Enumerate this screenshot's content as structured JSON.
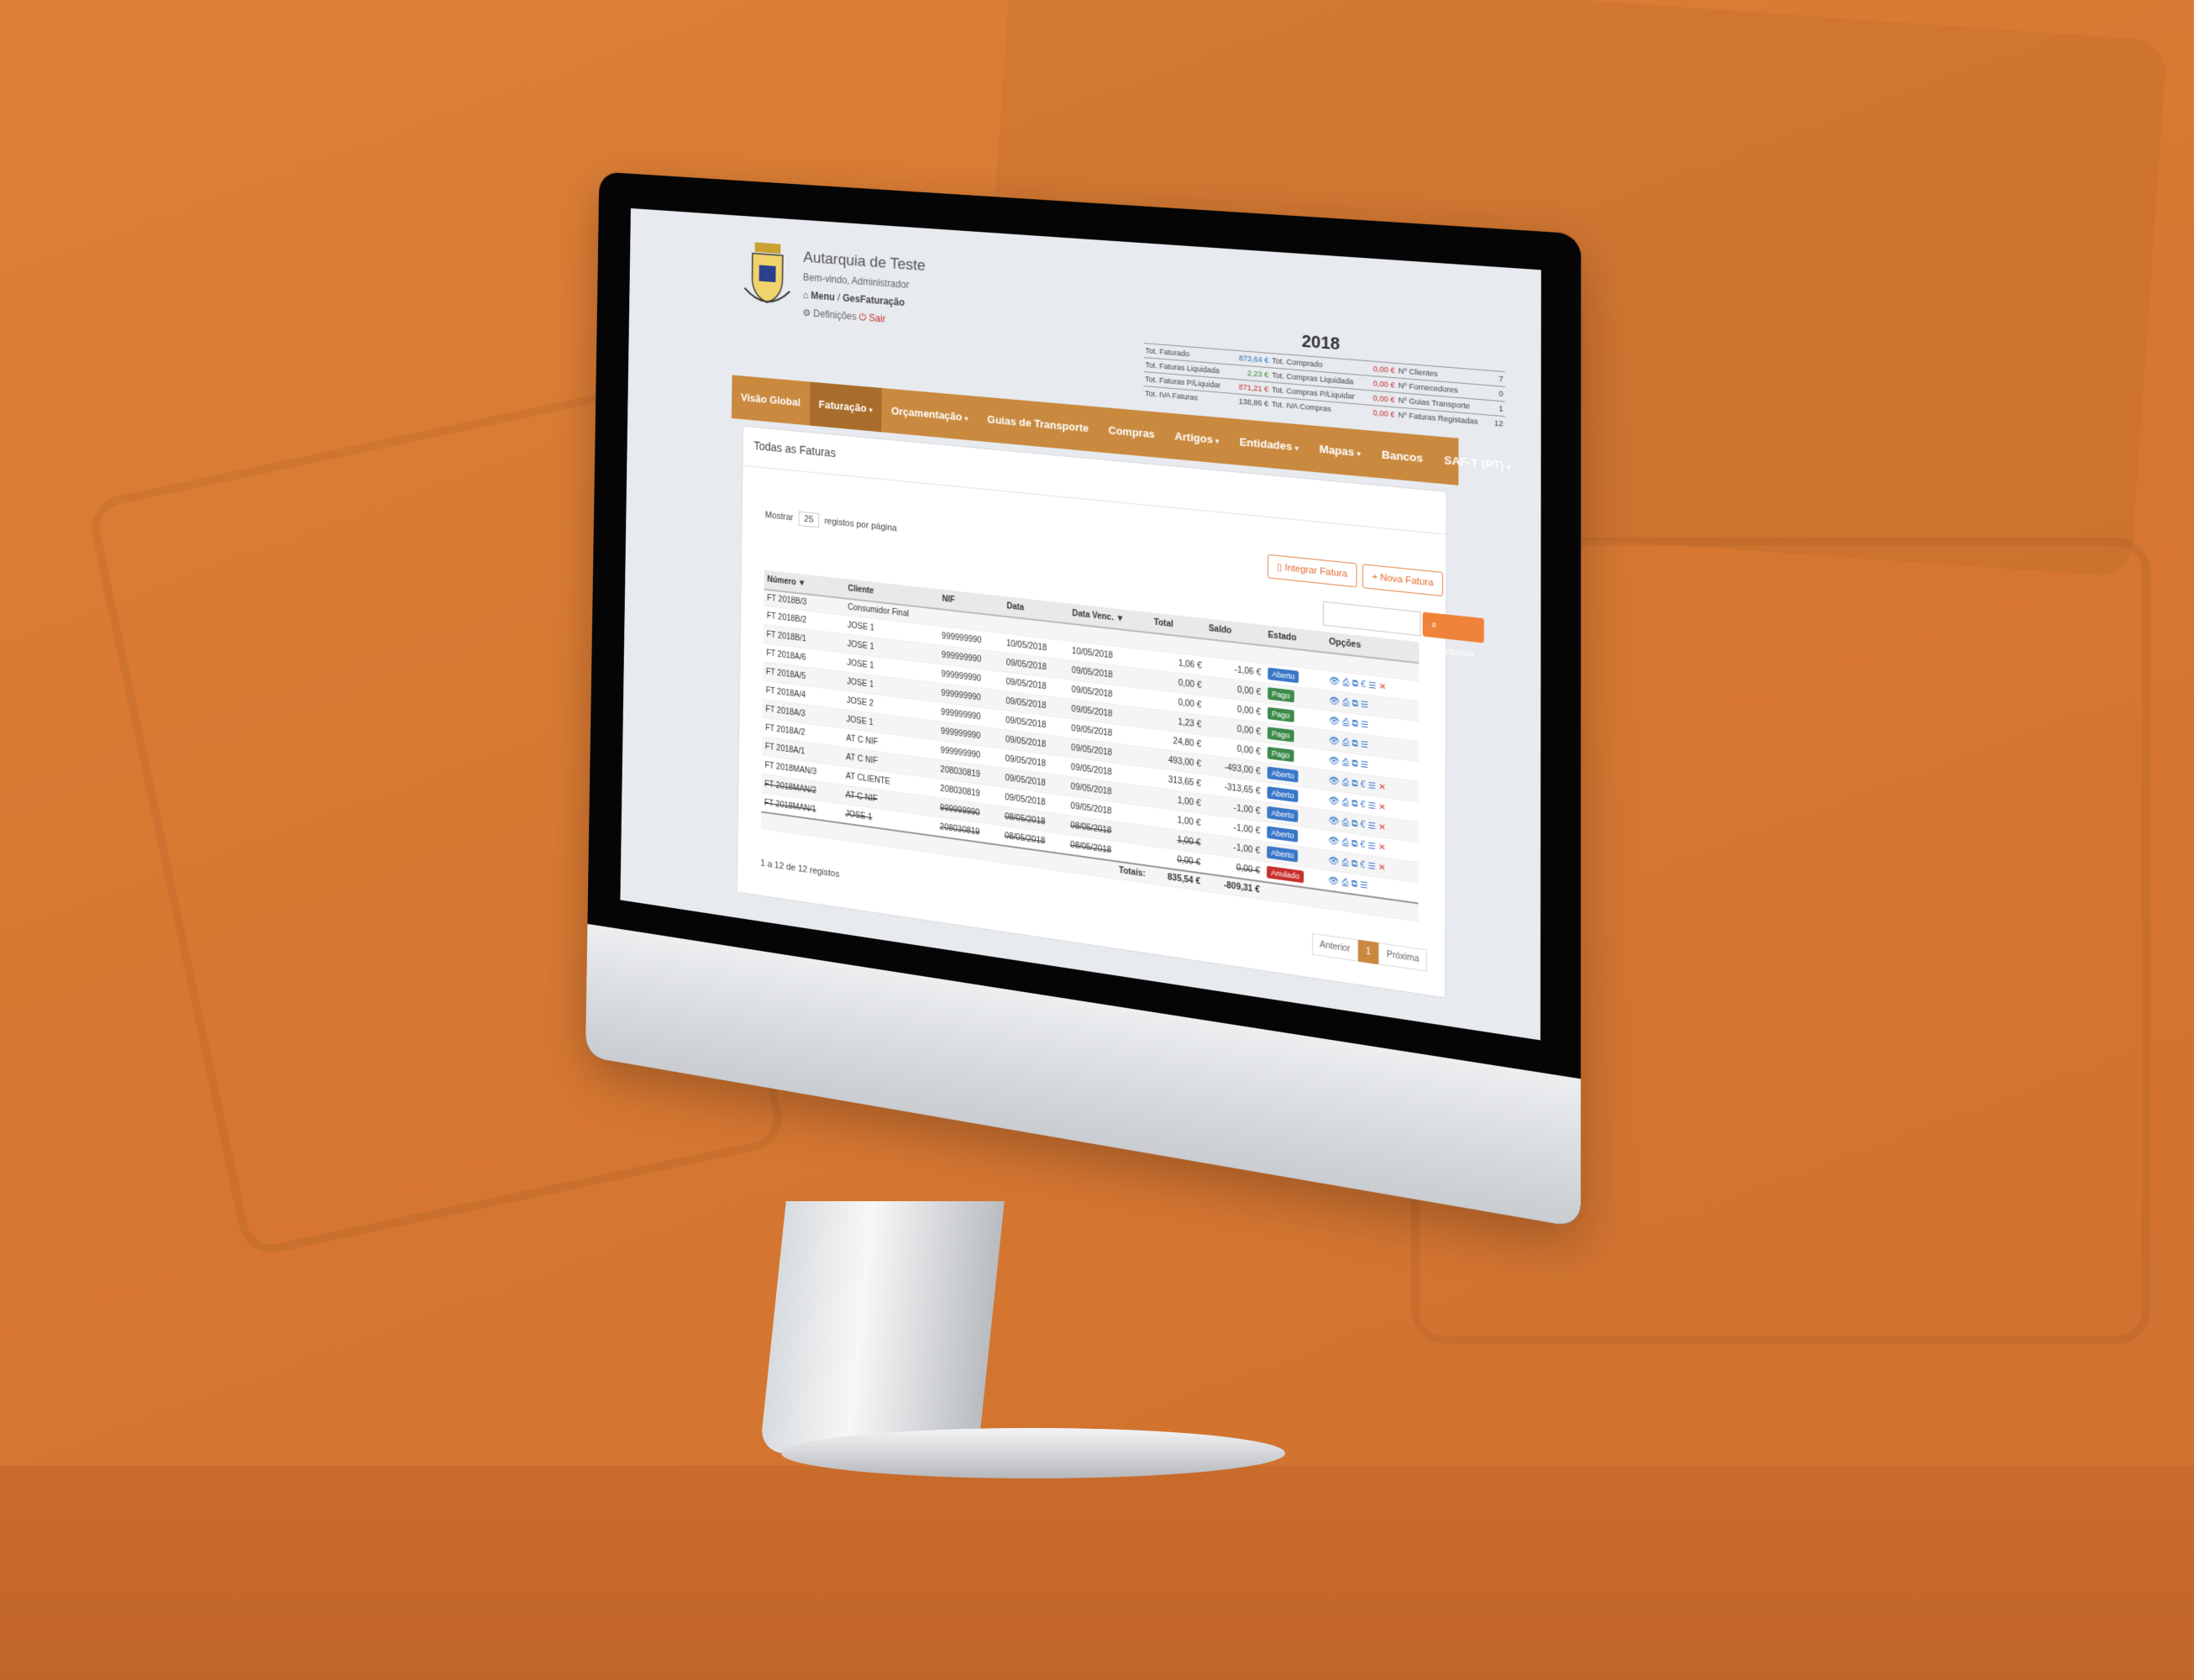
{
  "org": {
    "name": "Autarquia de Teste",
    "welcome": "Bem-vindo, Administrador",
    "menu": "Menu",
    "separator": "/",
    "module": "GesFaturação",
    "settings": "Definições",
    "logout": "Sair"
  },
  "stats": {
    "year": "2018",
    "rows": [
      [
        "Tot. Faturado",
        "873,64 €",
        "Tot. Comprado",
        "0,00 €",
        "Nº Clientes",
        "7"
      ],
      [
        "Tot. Faturas Liquidada",
        "2,23 €",
        "Tot. Compras Liquidada",
        "0,00 €",
        "Nº Fornecedores",
        "0"
      ],
      [
        "Tot. Faturas P/Liquidar",
        "871,21 €",
        "Tot. Compras P/Liquidar",
        "0,00 €",
        "Nº Guias Transporte",
        "1"
      ],
      [
        "Tot. IVA Faturas",
        "138,86 €",
        "Tot. IVA Compras",
        "0,00 €",
        "Nº Faturas Registadas",
        "12"
      ]
    ]
  },
  "nav": {
    "items": [
      {
        "label": "Visão Global",
        "caret": false
      },
      {
        "label": "Faturação",
        "caret": true
      },
      {
        "label": "Orçamentação",
        "caret": true
      },
      {
        "label": "Guias de Transporte",
        "caret": false
      },
      {
        "label": "Compras",
        "caret": false
      },
      {
        "label": "Artigos",
        "caret": true
      },
      {
        "label": "Entidades",
        "caret": true
      },
      {
        "label": "Mapas",
        "caret": true
      },
      {
        "label": "Bancos",
        "caret": false
      },
      {
        "label": "SAF-T (PT)",
        "caret": true
      }
    ],
    "caret_glyph": "▾"
  },
  "panel": {
    "title": "Todas as Faturas",
    "integrate_label": "Integrar Fatura",
    "new_label": "Nova Fatura",
    "show_prefix": "Mostrar",
    "show_value": "25",
    "show_suffix": "registos por página",
    "search_button": "Pesquisar",
    "count_text": "1 a 12 de 12 registos",
    "prev": "Anterior",
    "page": "1",
    "next": "Próxima"
  },
  "table": {
    "headers": [
      "Número",
      "Cliente",
      "NIF",
      "Data",
      "Data Venc.",
      "Total",
      "Saldo",
      "Estado",
      "Opções"
    ],
    "rows": [
      {
        "num": "FT 2018B/3",
        "num_class": "blue",
        "client": "Consumidor Final",
        "nif": "",
        "date": "",
        "due": "",
        "total": "",
        "saldo": "",
        "saldo_class": "",
        "state": "",
        "state_class": "",
        "ops": ""
      },
      {
        "num": "FT 2018B/2",
        "num_class": "green",
        "client": "JOSE 1",
        "nif": "999999990",
        "date": "10/05/2018",
        "due": "10/05/2018",
        "total": "1,06 €",
        "saldo": "-1,06 €",
        "saldo_class": "red",
        "state": "Aberto",
        "state_class": "b-open",
        "ops": "full"
      },
      {
        "num": "FT 2018B/1",
        "num_class": "green",
        "client": "JOSE 1",
        "nif": "999999990",
        "date": "09/05/2018",
        "due": "09/05/2018",
        "total": "0,00 €",
        "saldo": "0,00 €",
        "saldo_class": "",
        "state": "Pago",
        "state_class": "b-paid",
        "ops": "short"
      },
      {
        "num": "FT 2018A/6",
        "num_class": "green",
        "client": "JOSE 1",
        "nif": "999999990",
        "date": "09/05/2018",
        "due": "09/05/2018",
        "total": "0,00 €",
        "saldo": "0,00 €",
        "saldo_class": "",
        "state": "Pago",
        "state_class": "b-paid",
        "ops": "short"
      },
      {
        "num": "FT 2018A/5",
        "num_class": "green",
        "client": "JOSE 1",
        "nif": "999999990",
        "date": "09/05/2018",
        "due": "09/05/2018",
        "total": "1,23 €",
        "saldo": "0,00 €",
        "saldo_class": "",
        "state": "Pago",
        "state_class": "b-paid",
        "ops": "short"
      },
      {
        "num": "FT 2018A/4",
        "num_class": "blue",
        "client": "JOSE 2",
        "nif": "999999990",
        "date": "09/05/2018",
        "due": "09/05/2018",
        "total": "24,80 €",
        "saldo": "0,00 €",
        "saldo_class": "",
        "state": "Pago",
        "state_class": "b-paid",
        "ops": "short"
      },
      {
        "num": "FT 2018A/3",
        "num_class": "blue",
        "client": "JOSE 1",
        "nif": "999999990",
        "date": "09/05/2018",
        "due": "09/05/2018",
        "total": "493,00 €",
        "saldo": "-493,00 €",
        "saldo_class": "red",
        "state": "Aberto",
        "state_class": "b-open",
        "ops": "full"
      },
      {
        "num": "FT 2018A/2",
        "num_class": "blue",
        "client": "AT C NIF",
        "nif": "999999990",
        "date": "09/05/2018",
        "due": "09/05/2018",
        "total": "313,65 €",
        "saldo": "-313,65 €",
        "saldo_class": "red",
        "state": "Aberto",
        "state_class": "b-open",
        "ops": "full"
      },
      {
        "num": "FT 2018A/1",
        "num_class": "blue",
        "client": "AT C NIF",
        "nif": "208030819",
        "date": "09/05/2018",
        "due": "09/05/2018",
        "total": "1,00 €",
        "saldo": "-1,00 €",
        "saldo_class": "red",
        "state": "Aberto",
        "state_class": "b-open",
        "ops": "full"
      },
      {
        "num": "FT 2018MAN/3",
        "num_class": "blue",
        "client": "AT CLIENTE",
        "nif": "208030819",
        "date": "09/05/2018",
        "due": "09/05/2018",
        "total": "1,00 €",
        "saldo": "-1,00 €",
        "saldo_class": "red",
        "state": "Aberto",
        "state_class": "b-open",
        "ops": "full"
      },
      {
        "num": "FT 2018MAN/2",
        "num_class": "strike",
        "client": "AT C NIF",
        "nif": "999999990",
        "date": "08/05/2018",
        "due": "08/05/2018",
        "total": "1,00 €",
        "saldo": "-1,00 €",
        "saldo_class": "red",
        "state": "Aberto",
        "state_class": "b-open",
        "ops": "full"
      },
      {
        "num": "FT 2018MAN/1",
        "num_class": "strike",
        "client": "JOSE 1",
        "nif": "208030819",
        "date": "08/05/2018",
        "due": "08/05/2018",
        "total": "0,00 €",
        "saldo": "0,00 €",
        "saldo_class": "strike",
        "state": "Anulado",
        "state_class": "b-cancel",
        "ops": "short"
      }
    ],
    "totals_label": "Totais:",
    "totals_total": "835,54 €",
    "totals_saldo": "-809,31 €"
  },
  "icons": {
    "view": "👁",
    "print": "⎙",
    "copy": "⧉",
    "pay": "€",
    "list": "☰",
    "delete": "✕",
    "home": "⌂",
    "gear": "⚙",
    "power": "⏻",
    "doc": "▯",
    "plus": "+",
    "search": "⌕",
    "sort": "▼"
  },
  "colors": {
    "accent": "#c98a3f",
    "background": "#d97a34",
    "button": "#f0833a"
  }
}
